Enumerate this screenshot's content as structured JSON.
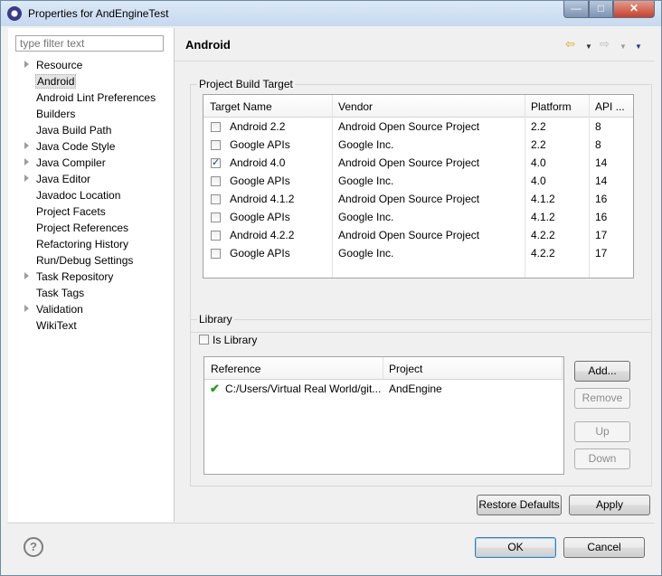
{
  "window": {
    "title": "Properties for AndEngineTest",
    "min_glyph": "—",
    "max_glyph": "□",
    "close_glyph": "✕"
  },
  "filter": {
    "placeholder": "type filter text"
  },
  "tree": [
    {
      "label": "Resource",
      "expandable": true
    },
    {
      "label": "Android",
      "expandable": false,
      "selected": true
    },
    {
      "label": "Android Lint Preferences",
      "expandable": false
    },
    {
      "label": "Builders",
      "expandable": false
    },
    {
      "label": "Java Build Path",
      "expandable": false
    },
    {
      "label": "Java Code Style",
      "expandable": true
    },
    {
      "label": "Java Compiler",
      "expandable": true
    },
    {
      "label": "Java Editor",
      "expandable": true
    },
    {
      "label": "Javadoc Location",
      "expandable": false
    },
    {
      "label": "Project Facets",
      "expandable": false
    },
    {
      "label": "Project References",
      "expandable": false
    },
    {
      "label": "Refactoring History",
      "expandable": false
    },
    {
      "label": "Run/Debug Settings",
      "expandable": false
    },
    {
      "label": "Task Repository",
      "expandable": true
    },
    {
      "label": "Task Tags",
      "expandable": false
    },
    {
      "label": "Validation",
      "expandable": true
    },
    {
      "label": "WikiText",
      "expandable": false
    }
  ],
  "page": {
    "title": "Android",
    "nav_back": "⇦",
    "nav_forward": "⇨",
    "dropdown": "▼"
  },
  "build_target": {
    "label": "Project Build Target",
    "columns": [
      "Target Name",
      "Vendor",
      "Platform",
      "API ..."
    ],
    "rows": [
      {
        "name": "Android 2.2",
        "vendor": "Android Open Source Project",
        "platform": "2.2",
        "api": "8",
        "checked": false
      },
      {
        "name": "Google APIs",
        "vendor": "Google Inc.",
        "platform": "2.2",
        "api": "8",
        "checked": false
      },
      {
        "name": "Android 4.0",
        "vendor": "Android Open Source Project",
        "platform": "4.0",
        "api": "14",
        "checked": true
      },
      {
        "name": "Google APIs",
        "vendor": "Google Inc.",
        "platform": "4.0",
        "api": "14",
        "checked": false
      },
      {
        "name": "Android 4.1.2",
        "vendor": "Android Open Source Project",
        "platform": "4.1.2",
        "api": "16",
        "checked": false
      },
      {
        "name": "Google APIs",
        "vendor": "Google Inc.",
        "platform": "4.1.2",
        "api": "16",
        "checked": false
      },
      {
        "name": "Android 4.2.2",
        "vendor": "Android Open Source Project",
        "platform": "4.2.2",
        "api": "17",
        "checked": false
      },
      {
        "name": "Google APIs",
        "vendor": "Google Inc.",
        "platform": "4.2.2",
        "api": "17",
        "checked": false
      }
    ]
  },
  "library": {
    "label": "Library",
    "is_library_label": "Is Library",
    "is_library_checked": false,
    "columns": [
      "Reference",
      "Project"
    ],
    "rows": [
      {
        "reference": "C:/Users/Virtual Real World/git...",
        "project": "AndEngine",
        "status_icon": "✔"
      }
    ],
    "buttons": {
      "add": "Add...",
      "remove": "Remove",
      "up": "Up",
      "down": "Down"
    }
  },
  "actions": {
    "restore_defaults": "Restore Defaults",
    "apply": "Apply",
    "ok": "OK",
    "cancel": "Cancel",
    "help_glyph": "?"
  },
  "colors": {
    "accent_check": "#1e9c1e",
    "title_gradient_top": "#dce9f7",
    "close_button": "#c5412b"
  }
}
